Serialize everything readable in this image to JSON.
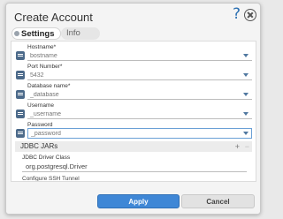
{
  "dialog": {
    "title": "Create Account",
    "help_glyph": "?",
    "tabs": [
      {
        "label": "Settings",
        "active": true
      },
      {
        "label": "Info",
        "active": false
      }
    ]
  },
  "fields": [
    {
      "label": "Hostname*",
      "placeholder": "bostname"
    },
    {
      "label": "Port Number*",
      "placeholder": "5432"
    },
    {
      "label": "Database name*",
      "placeholder": "_database"
    },
    {
      "label": "Username",
      "placeholder": "_username"
    },
    {
      "label": "Password",
      "placeholder": "_password"
    }
  ],
  "jdbc_section": {
    "title": "JDBC JARs",
    "add_glyph": "+",
    "remove_glyph": "−",
    "driver_class_label": "JDBC Driver Class",
    "driver_class_value": "org.postgresql.Driver",
    "next_label": "Configure SSH Tunnel"
  },
  "footer": {
    "apply_label": "Apply",
    "cancel_label": "Cancel"
  },
  "colors": {
    "accent": "#3f87d6",
    "chip": "#4c6a8a"
  }
}
